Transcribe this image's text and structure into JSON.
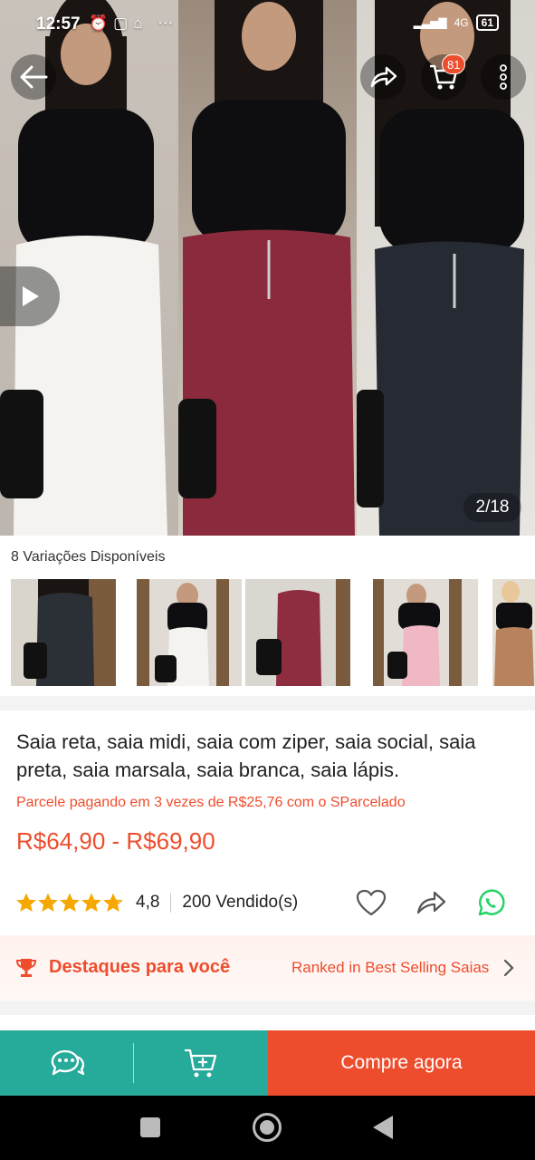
{
  "status_bar": {
    "time": "12:57",
    "battery": "61",
    "network": "4G"
  },
  "hero": {
    "counter": "2/18"
  },
  "header": {
    "cart_badge": "81"
  },
  "variations": {
    "title": "8 Variações Disponíveis",
    "items": [
      {
        "name": "black-skirt",
        "color": "#2b2f36"
      },
      {
        "name": "white-skirt",
        "color": "#f2f2f0"
      },
      {
        "name": "wine-skirt",
        "color": "#8e2c40"
      },
      {
        "name": "pink-skirt",
        "color": "#f0b7c4"
      },
      {
        "name": "caramel-skirt",
        "color": "#b8835c"
      }
    ]
  },
  "product": {
    "title": "Saia reta, saia midi, saia com ziper, saia social, saia preta, saia marsala, saia branca, saia lápis.",
    "installment": "Parcele pagando em 3 vezes de R$25,76 com o SParcelado",
    "price": "R$64,90 - R$69,90",
    "rating": "4,8",
    "rating_fraction": 0.96,
    "sold": "200 Vendido(s)"
  },
  "highlights": {
    "label": "Destaques para você",
    "ranked": "Ranked in Best Selling Saias"
  },
  "actions": {
    "buy_label": "Compre agora"
  },
  "colors": {
    "accent": "#ee4d2d",
    "teal": "#26aa99",
    "star": "#f6a700",
    "whatsapp": "#25d366"
  }
}
